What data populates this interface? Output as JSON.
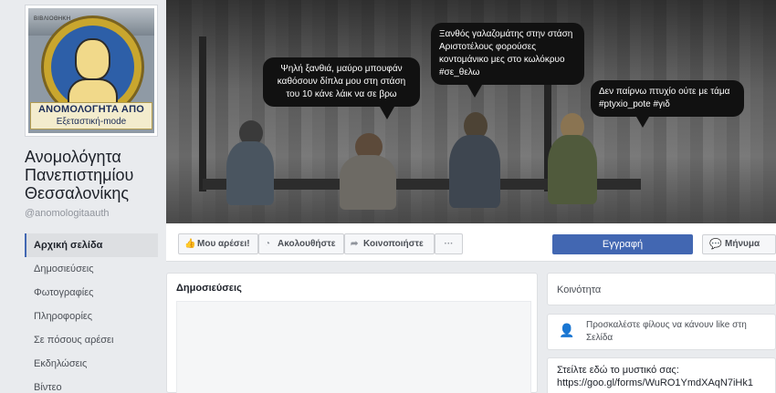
{
  "page": {
    "name": "Ανομολόγητα Πανεπιστημίου Θεσσαλονίκης",
    "username": "@anomologitaauth"
  },
  "profile_picture": {
    "building_sign": "ΒΙΒΛΙΟΘΗΚΗ",
    "banner_line1": "ΑΝΟΜΟΛΟΓΗΤΑ ΑΠΟ",
    "banner_line2": "Εξεταστική-mode"
  },
  "nav": {
    "items": [
      {
        "label": "Αρχική σελίδα",
        "active": true
      },
      {
        "label": "Δημοσιεύσεις"
      },
      {
        "label": "Φωτογραφίες"
      },
      {
        "label": "Πληροφορίες"
      },
      {
        "label": "Σε πόσους αρέσει"
      },
      {
        "label": "Εκδηλώσεις"
      },
      {
        "label": "Βίντεο"
      }
    ]
  },
  "cover": {
    "bubble1": "Ψηλή ξανθιά, μαύρο μπουφάν καθόσουν δίπλα μου στη στάση του 10 κάνε λάικ να σε βρω",
    "bubble2": "Ξανθός γαλαζομάτης στην στάση Αριστοτέλους φορούσες κοντομάνικο μες στο κωλόκρυο #σε_θελω",
    "bubble3": "Δεν παίρνω πτυχίο ούτε με τάμα #ptyxio_pote #γιδ"
  },
  "actions": {
    "like_label": "Μου αρέσει!",
    "follow_label": "Ακολουθήστε",
    "share_label": "Κοινοποιήστε",
    "more_label": "···",
    "signup_label": "Εγγραφή",
    "message_label": "Μήνυμα"
  },
  "posts": {
    "title": "Δημοσιεύσεις"
  },
  "community": {
    "title": "Κοινότητα",
    "invite_text": "Προσκαλέστε φίλους να κάνουν like στη Σελίδα",
    "secret_text": "Στείλτε εδώ το μυστικό σας: https://goo.gl/forms/WuRO1YmdXAqN7iHk1"
  },
  "colors": {
    "accent": "#4267b2",
    "background": "#e9ebee"
  }
}
